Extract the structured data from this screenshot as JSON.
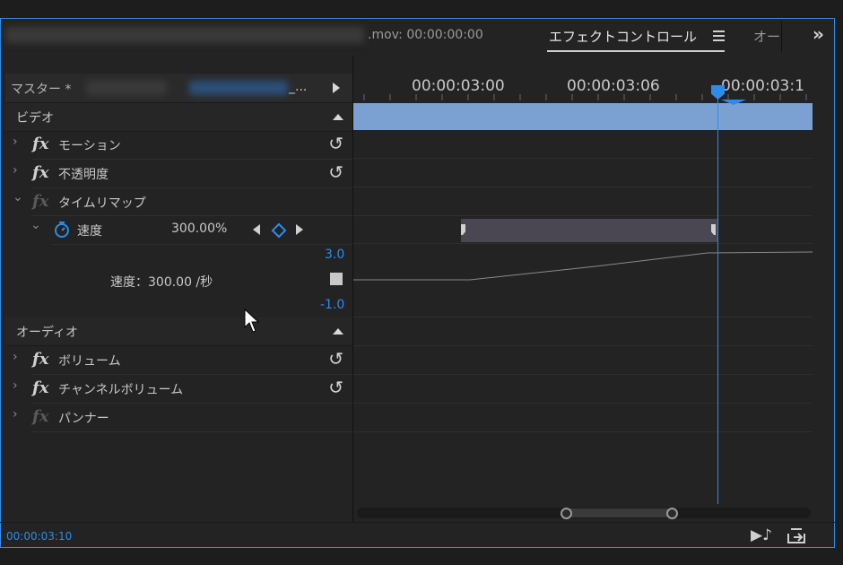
{
  "header": {
    "clip_name_suffix": ".mov: 00:00:00:00",
    "tab_effect_controls": "エフェクトコントロール",
    "tab_menu_icon": "hamburger-icon",
    "tab_next": "オー",
    "overflow_icon": "double-chevron-right-icon"
  },
  "master": {
    "label": "マスター *",
    "link_suffix": "_..."
  },
  "sections": {
    "video": "ビデオ",
    "audio": "オーディオ"
  },
  "effects": {
    "motion": "モーション",
    "opacity": "不透明度",
    "time_remap": "タイムリマップ",
    "speed_label": "速度",
    "speed_value": "300.00%",
    "speed_graph_label": "速度：300.00 /秒",
    "graph_max": "3.0",
    "graph_min": "-1.0",
    "volume": "ボリューム",
    "channel_volume": "チャンネルボリューム",
    "panner": "パンナー"
  },
  "ruler": {
    "tc1": "00:00:03:00",
    "tc2": "00:00:03:06",
    "tc3": "00:00:03:1"
  },
  "footer": {
    "timecode": "00:00:03:10"
  },
  "colors": {
    "accent": "#2d8ceb",
    "clip_bar": "#7ba0d2",
    "keyframe_range": "#4a4652"
  }
}
